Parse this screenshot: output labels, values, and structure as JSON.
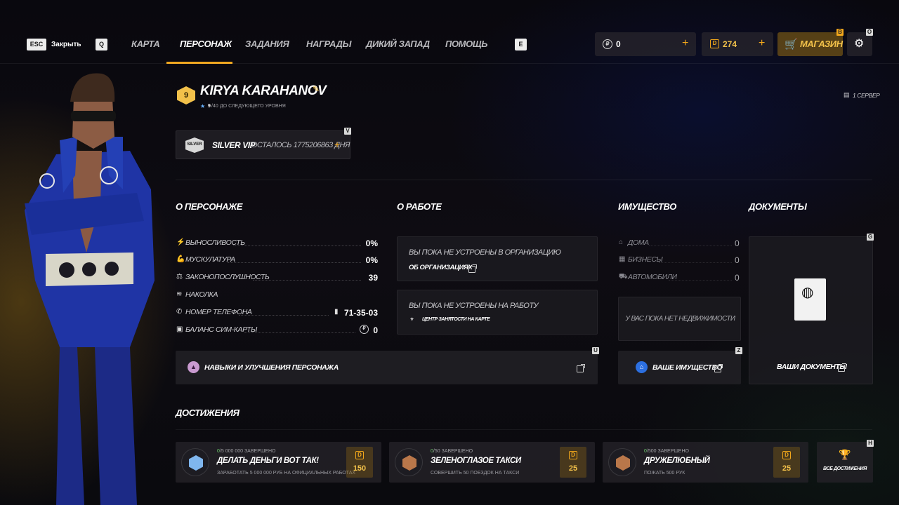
{
  "topbar": {
    "close_key": "ESC",
    "close_label": "Закрыть",
    "left_key": "Q",
    "right_key": "E",
    "tabs": [
      {
        "label": "КАРТА"
      },
      {
        "label": "ПЕРСОНАЖ"
      },
      {
        "label": "ЗАДАНИЯ"
      },
      {
        "label": "НАГРАДЫ"
      },
      {
        "label": "ДИКИЙ ЗАПАД"
      },
      {
        "label": "ПОМОЩЬ"
      }
    ],
    "currency_main": "0",
    "currency_donate": "274",
    "shop_label": "МАГАЗИН",
    "shop_key": "B",
    "settings_key": "O",
    "plus": "+"
  },
  "profile": {
    "level": "9",
    "name": "KIRYA KARAHANOV",
    "progress_current": "9",
    "progress_total": "/40",
    "progress_text": "ДО СЛЕДУЮЩЕГО УРОВНЯ",
    "server": "1 СЕРВЕР",
    "vip_badge": "SILVER",
    "vip_label": "SILVER VIP",
    "vip_remaining": "ОСТАЛОСЬ 1775206863 ДНЯ",
    "vip_key": "V"
  },
  "about": {
    "title": "О ПЕРСОНАЖЕ",
    "stats": [
      {
        "label": "ВЫНОСЛИВОСТЬ",
        "value": "0%"
      },
      {
        "label": "МУСКУЛАТУРА",
        "value": "0%"
      },
      {
        "label": "ЗАКОНОПОСЛУШНОСТЬ",
        "value": "39"
      },
      {
        "label": "НАКОЛКА",
        "value": ""
      },
      {
        "label": "НОМЕР ТЕЛЕФОНА",
        "value": "71-35-03"
      },
      {
        "label": "БАЛАНС СИМ-КАРТЫ",
        "value": "0"
      }
    ],
    "skills_label": "НАВЫКИ И УЛУЧШЕНИЯ ПЕРСОНАЖА",
    "skills_key": "U"
  },
  "work": {
    "title": "О РАБОТЕ",
    "org_text": "ВЫ ПОКА НЕ УСТРОЕНЫ В ОРГАНИЗАЦИЮ",
    "org_link": "ОБ ОРГАНИЗАЦИЯХ",
    "job_text": "ВЫ ПОКА НЕ УСТРОЕНЫ НА РАБОТУ",
    "job_link": "ЦЕНТР ЗАНЯТОСТИ НА КАРТЕ"
  },
  "property": {
    "title": "ИМУЩЕСТВО",
    "items": [
      {
        "label": "ДОМА",
        "value": "0"
      },
      {
        "label": "БИЗНЕСЫ",
        "value": "0"
      },
      {
        "label": "АВТОМОБИЛИ",
        "value": "0"
      }
    ],
    "empty_text": "У ВАС ПОКА НЕТ НЕДВИЖИМОСТИ",
    "link_label": "ВАШЕ ИМУЩЕСТВО",
    "link_key": "Z"
  },
  "documents": {
    "title": "ДОКУМЕНТЫ",
    "link_label": "ВАШИ ДОКУМЕНТЫ",
    "key": "G"
  },
  "achievements": {
    "title": "ДОСТИЖЕНИЯ",
    "key": "H",
    "all_label": "ВСЕ ДОСТИЖЕНИЯ",
    "completed_word": "ЗАВЕРШЕНО",
    "items": [
      {
        "done": "0",
        "total": "/5 000 000",
        "name": "ДЕЛАТЬ ДЕНЬГИ ВОТ ТАК!",
        "desc": "ЗАРАБОТАТЬ 5 000 000 РУБ НА ОФИЦИАЛЬНЫХ РАБОТАХ",
        "reward": "150",
        "medal": "diamond"
      },
      {
        "done": "0",
        "total": "/50",
        "name": "ЗЕЛЕНОГЛАЗОЕ ТАКСИ",
        "desc": "СОВЕРШИТЬ 50 ПОЕЗДОК НА ТАКСИ",
        "reward": "25",
        "medal": "bronze"
      },
      {
        "done": "0",
        "total": "/500",
        "name": "ДРУЖЕЛЮБНЫЙ",
        "desc": "ПОЖАТЬ 500 РУК",
        "reward": "25",
        "medal": "bronze"
      }
    ]
  },
  "colors": {
    "accent": "#f2a71b",
    "vip_badge": "#d9d9d9",
    "diamond_medal": "#7fb6ee",
    "bronze_medal": "#b9774a"
  }
}
